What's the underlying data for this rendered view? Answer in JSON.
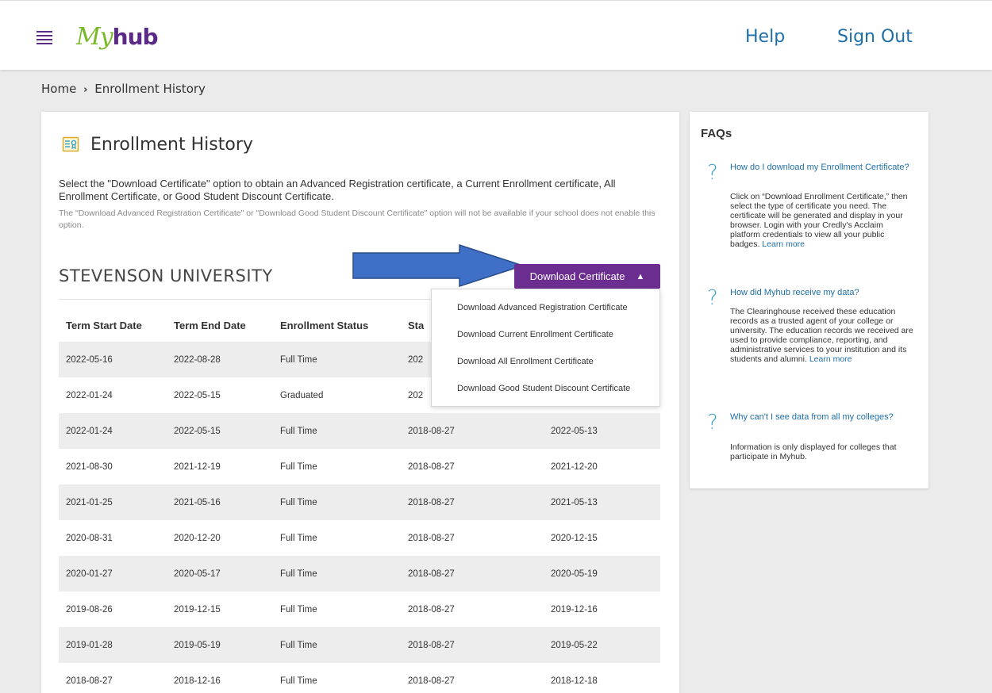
{
  "header": {
    "logo_my": "My",
    "logo_hub": "hub",
    "help_label": "Help",
    "signout_label": "Sign Out"
  },
  "breadcrumb": {
    "home": "Home",
    "separator": "›",
    "current": "Enrollment History"
  },
  "main": {
    "title": "Enrollment History",
    "instructions": "Select the \"Download Certificate\" option to obtain an Advanced Registration certificate, a Current Enrollment certificate, All Enrollment Certificate, or Good Student Discount Certificate.",
    "note": "The \"Download Advanced Registration Certificate\" or \"Download Good Student Discount Certificate\" option will not be available if your school does not enable this option.",
    "school_name": "STEVENSON UNIVERSITY",
    "download_button": "Download Certificate",
    "dropdown_items": [
      "Download Advanced Registration Certificate",
      "Download Current Enrollment Certificate",
      "Download All Enrollment Certificate",
      "Download Good Student Discount Certificate"
    ],
    "columns": [
      "Term Start Date",
      "Term End Date",
      "Enrollment Status",
      "Sta"
    ],
    "rows": [
      [
        "2022-05-16",
        "2022-08-28",
        "Full Time",
        "202",
        ""
      ],
      [
        "2022-01-24",
        "2022-05-15",
        "Graduated",
        "202",
        ""
      ],
      [
        "2022-01-24",
        "2022-05-15",
        "Full Time",
        "2018-08-27",
        "2022-05-13"
      ],
      [
        "2021-08-30",
        "2021-12-19",
        "Full Time",
        "2018-08-27",
        "2021-12-20"
      ],
      [
        "2021-01-25",
        "2021-05-16",
        "Full Time",
        "2018-08-27",
        "2021-05-13"
      ],
      [
        "2020-08-31",
        "2020-12-20",
        "Full Time",
        "2018-08-27",
        "2020-12-15"
      ],
      [
        "2020-01-27",
        "2020-05-17",
        "Full Time",
        "2018-08-27",
        "2020-05-19"
      ],
      [
        "2019-08-26",
        "2019-12-15",
        "Full Time",
        "2018-08-27",
        "2019-12-16"
      ],
      [
        "2019-01-28",
        "2019-05-19",
        "Full Time",
        "2018-08-27",
        "2019-05-22"
      ],
      [
        "2018-08-27",
        "2018-12-16",
        "Full Time",
        "2018-08-27",
        "2018-12-18"
      ]
    ]
  },
  "faq": {
    "title": "FAQs",
    "icon_glyph": "?",
    "items": [
      {
        "question": "How do I download my Enrollment Certificate?",
        "answer": "Click on “Download Enrollment Certificate,” then select the type of certificate you need. The certificate will be generated and display in your browser. Login with your Credly's Acclaim platform credentials to view all your public badges.",
        "learn_more": "Learn more"
      },
      {
        "question": "How did Myhub receive my data?",
        "answer": "The Clearinghouse received these education records as a trusted agent of your college or university. The education records we received are used to provide compliance, reporting, and administrative services to your institution and its students and alumni.",
        "learn_more": "Learn more"
      },
      {
        "question": "Why can't I see data from all my colleges?",
        "answer": "Information is only displayed for colleges that participate in Myhub.",
        "learn_more": ""
      }
    ]
  },
  "colors": {
    "brand_purple": "#6c2d91",
    "logo_green": "#79b828",
    "link_blue": "#1f6fa8",
    "arrow_fill": "#3f6fc6",
    "arrow_stroke": "#2a4d8a"
  }
}
